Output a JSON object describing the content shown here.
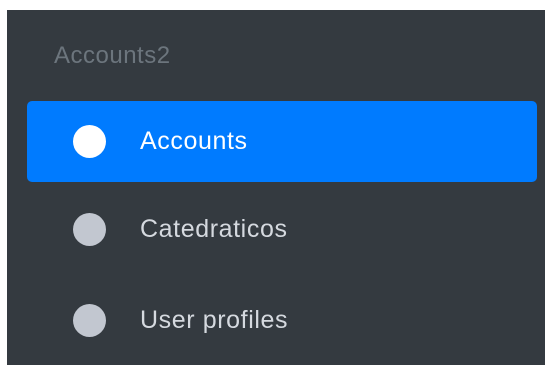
{
  "sidebar": {
    "section_header": "Accounts2",
    "items": [
      {
        "label": "Accounts",
        "icon": "circle-icon",
        "active": true
      },
      {
        "label": "Catedraticos",
        "icon": "circle-icon",
        "active": false
      },
      {
        "label": "User profiles",
        "icon": "circle-icon",
        "active": false
      }
    ]
  },
  "colors": {
    "sidebar_bg": "#343a40",
    "active_bg": "#007bff",
    "header_text": "#6c757d",
    "active_icon": "#ffffff",
    "inactive_icon": "#c2c7d0"
  }
}
